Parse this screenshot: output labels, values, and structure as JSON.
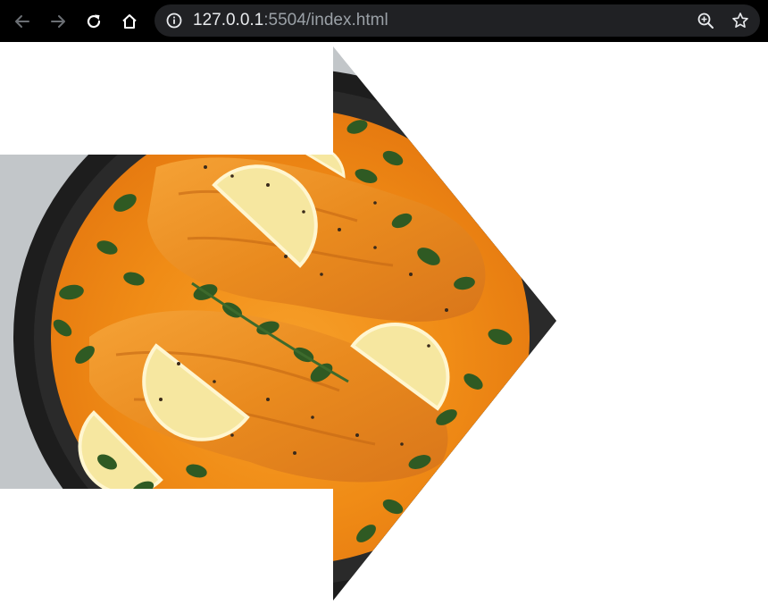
{
  "browser": {
    "address_bar": {
      "host": "127.0.0.1",
      "rest": ":5504/index.html"
    },
    "icons": {
      "back": "arrow-left-icon",
      "forward": "arrow-right-icon",
      "reload": "reload-icon",
      "home": "home-icon",
      "site_info": "info-icon",
      "zoom": "zoom-in-icon",
      "bookmark": "star-icon"
    }
  },
  "page": {
    "image": {
      "subject": "salmon-curry-dish-image",
      "shape": "arrow-pointing-right"
    }
  }
}
